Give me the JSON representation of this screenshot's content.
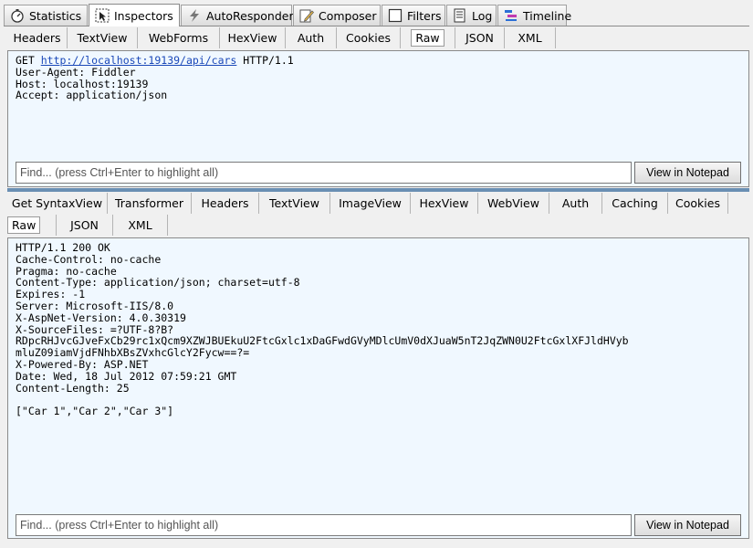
{
  "top_tabs": [
    {
      "label": "Statistics",
      "icon": "stopwatch-icon",
      "active": false
    },
    {
      "label": "Inspectors",
      "icon": "inspect-icon",
      "active": true
    },
    {
      "label": "AutoResponder",
      "icon": "lightning-icon",
      "active": false
    },
    {
      "label": "Composer",
      "icon": "pencil-icon",
      "active": false
    },
    {
      "label": "Filters",
      "icon": "checkbox-icon",
      "active": false
    },
    {
      "label": "Log",
      "icon": "log-icon",
      "active": false
    },
    {
      "label": "Timeline",
      "icon": "timeline-icon",
      "active": false
    }
  ],
  "request": {
    "tabs": [
      "Headers",
      "TextView",
      "WebForms",
      "HexView",
      "Auth",
      "Cookies",
      "Raw",
      "JSON",
      "XML"
    ],
    "active_tab": "Raw",
    "method": "GET",
    "url": "http://localhost:19139/api/cars",
    "protocol": "HTTP/1.1",
    "headers": "User-Agent: Fiddler\nHost: localhost:19139\nAccept: application/json",
    "find_placeholder": "Find... (press Ctrl+Enter to highlight all)",
    "notepad_label": "View in Notepad"
  },
  "response": {
    "tabs_row1": [
      "Get SyntaxView",
      "Transformer",
      "Headers",
      "TextView",
      "ImageView",
      "HexView",
      "WebView",
      "Auth",
      "Caching",
      "Cookies"
    ],
    "tabs_row2": [
      "Raw",
      "JSON",
      "XML"
    ],
    "active_tab": "Raw",
    "raw": "HTTP/1.1 200 OK\nCache-Control: no-cache\nPragma: no-cache\nContent-Type: application/json; charset=utf-8\nExpires: -1\nServer: Microsoft-IIS/8.0\nX-AspNet-Version: 4.0.30319\nX-SourceFiles: =?UTF-8?B?\nRDpcRHJvcGJveFxCb29rc1xQcm9XZWJBUEkuU2FtcGxlc1xDaGFwdGVyMDlcUmV0dXJuaW5nT2JqZWN0U2FtcGxlXFJldHVyb\nmluZ09iamVjdFNhbXBsZVxhcGlcY2Fycw==?=\nX-Powered-By: ASP.NET\nDate: Wed, 18 Jul 2012 07:59:21 GMT\nContent-Length: 25\n\n[\"Car 1\",\"Car 2\",\"Car 3\"]",
    "find_placeholder": "Find... (press Ctrl+Enter to highlight all)",
    "notepad_label": "View in Notepad"
  },
  "colors": {
    "pane_bg": "#f0f8ff",
    "link": "#1a48b8",
    "splitter": "#6a8fb3"
  }
}
